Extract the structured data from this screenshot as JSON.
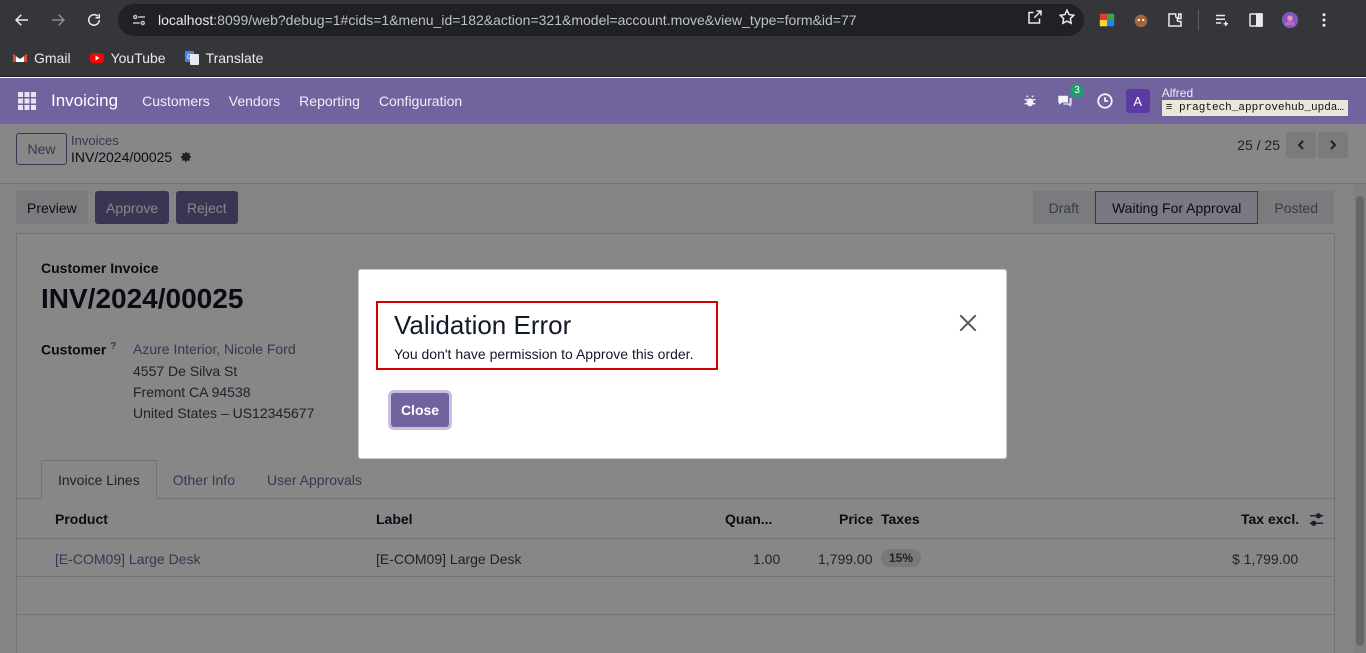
{
  "browser": {
    "url_host": "localhost",
    "url_rest": ":8099/web?debug=1#cids=1&menu_id=182&action=321&model=account.move&view_type=form&id=77",
    "bookmarks": [
      {
        "label": "Gmail",
        "icon": "gmail-icon"
      },
      {
        "label": "YouTube",
        "icon": "youtube-icon"
      },
      {
        "label": "Translate",
        "icon": "translate-icon"
      }
    ]
  },
  "navbar": {
    "brand": "Invoicing",
    "menu": [
      "Customers",
      "Vendors",
      "Reporting",
      "Configuration"
    ],
    "chat_count": "3",
    "avatar_letter": "A",
    "user_name": "Alfred",
    "database": "pragtech_approvehub_upda…",
    "color": "#71639e"
  },
  "control_panel": {
    "new_label": "New",
    "breadcrumb_parent": "Invoices",
    "breadcrumb_current": "INV/2024/00025",
    "pager": "25 / 25"
  },
  "actions": {
    "preview": "Preview",
    "approve": "Approve",
    "reject": "Reject"
  },
  "statusbar": {
    "stages": [
      "Draft",
      "Waiting For Approval",
      "Posted"
    ],
    "active": "Waiting For Approval"
  },
  "invoice": {
    "type": "Customer Invoice",
    "name": "INV/2024/00025",
    "customer_label": "Customer",
    "customer_help": "?",
    "customer_name": "Azure Interior, Nicole Ford",
    "address": [
      "4557 De Silva St",
      "Fremont CA 94538",
      "United States – US12345677"
    ]
  },
  "tabs": [
    "Invoice Lines",
    "Other Info",
    "User Approvals"
  ],
  "lines": {
    "headers": {
      "product": "Product",
      "label": "Label",
      "quantity": "Quan...",
      "price": "Price",
      "taxes": "Taxes",
      "tax_excl": "Tax excl."
    },
    "rows": [
      {
        "product": "[E-COM09] Large Desk",
        "label": "[E-COM09] Large Desk",
        "quantity": "1.00",
        "price": "1,799.00",
        "taxes": "15%",
        "subtotal": "$ 1,799.00"
      }
    ]
  },
  "dialog": {
    "title": "Validation Error",
    "message": "You don't have permission to Approve this order.",
    "close_label": "Close",
    "highlight_color": "#d40000"
  }
}
